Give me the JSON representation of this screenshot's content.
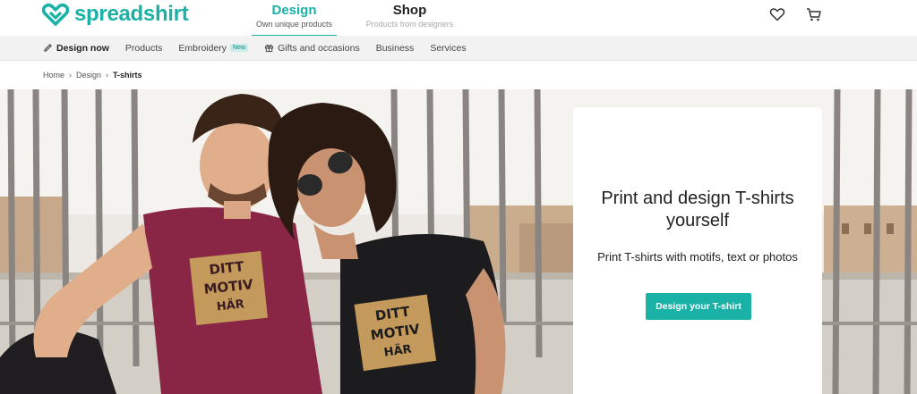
{
  "brand": {
    "name": "spreadshirt",
    "color": "#1ab2a7"
  },
  "header": {
    "tabs": [
      {
        "label": "Design",
        "sub": "Own unique products",
        "active": true
      },
      {
        "label": "Shop",
        "sub": "Products from designers",
        "active": false
      }
    ],
    "icons": [
      "heart-icon",
      "cart-icon"
    ]
  },
  "nav": {
    "items": [
      {
        "label": "Design now",
        "icon": "pencil-icon"
      },
      {
        "label": "Products"
      },
      {
        "label": "Embroidery",
        "badge": "New"
      },
      {
        "label": "Gifts and occasions",
        "icon": "gift-icon"
      },
      {
        "label": "Business"
      },
      {
        "label": "Services"
      }
    ]
  },
  "breadcrumb": [
    "Home",
    "Design",
    "T-shirts"
  ],
  "hero": {
    "shirt_text": [
      "DITT",
      "MOTIV",
      "HÄR"
    ],
    "title": "Print and design T-shirts yourself",
    "subtitle": "Print T-shirts with motifs, text or photos",
    "cta": "Design your T-shirt"
  }
}
